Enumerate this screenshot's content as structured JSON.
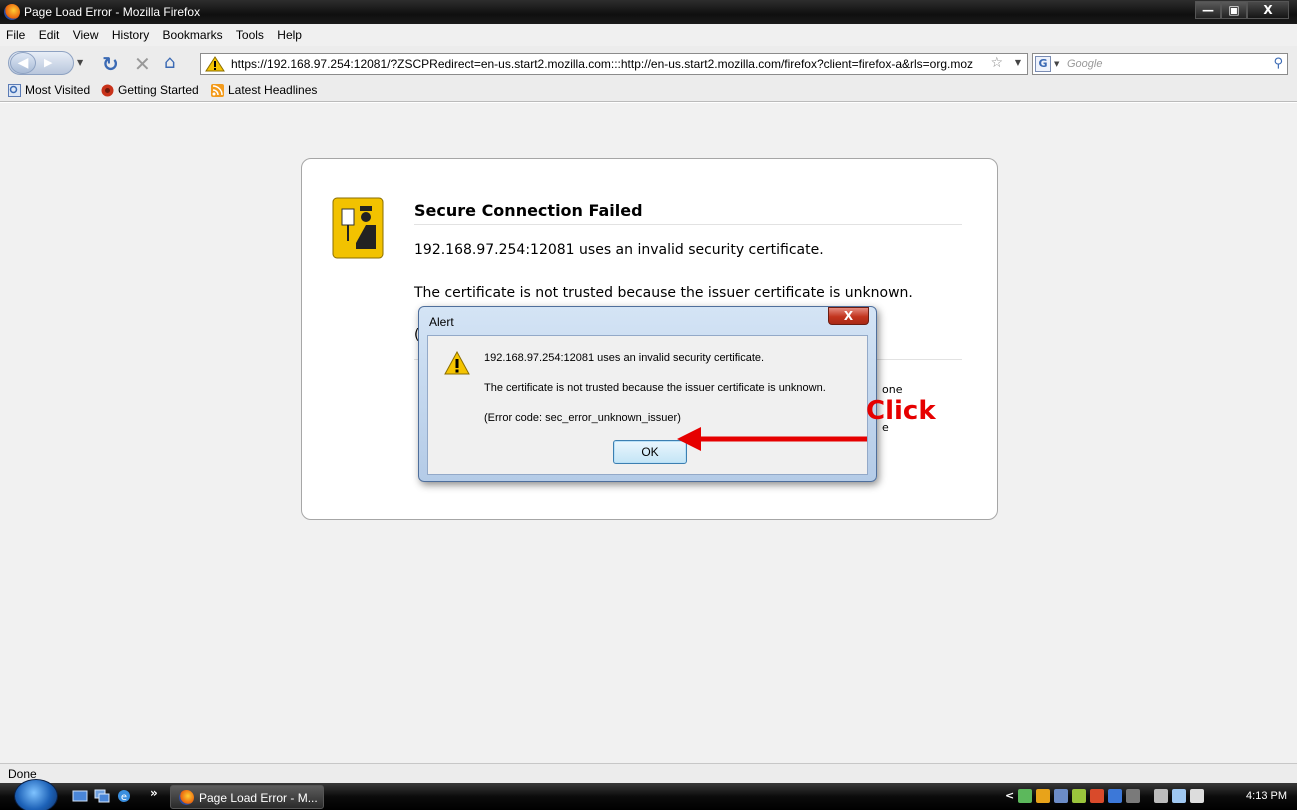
{
  "window": {
    "title": "Page Load Error - Mozilla Firefox",
    "controls": {
      "minimize": "—",
      "maximize": "▣",
      "close": "X"
    }
  },
  "menu": [
    "File",
    "Edit",
    "View",
    "History",
    "Bookmarks",
    "Tools",
    "Help"
  ],
  "navigation": {
    "url": "https://192.168.97.254:12081/?ZSCPRedirect=en-us.start2.mozilla.com:::http://en-us.start2.mozilla.com/firefox?client=firefox-a&rls=org.moz",
    "search_placeholder": "Google",
    "icons": [
      "back-icon",
      "forward-icon",
      "reload-icon",
      "stop-icon",
      "home-icon",
      "site-warning-icon",
      "bookmark-star-icon",
      "search-icon"
    ]
  },
  "bookmarks": [
    "Most Visited",
    "Getting Started",
    "Latest Headlines"
  ],
  "error_page": {
    "title": "Secure Connection Failed",
    "line1": "192.168.97.254:12081 uses an invalid security certificate.",
    "line2": "The certificate is not trusted because the issuer certificate is unknown.",
    "fragment_paren": "(",
    "fragment_one": "one",
    "fragment_e": "e"
  },
  "alert": {
    "title": "Alert",
    "close_label": "X",
    "messages": [
      "192.168.97.254:12081 uses an invalid security certificate.",
      "The certificate is not trusted because the issuer certificate is unknown.",
      "(Error code: sec_error_unknown_issuer)"
    ],
    "ok_label": "OK"
  },
  "annotation": {
    "label": "Click",
    "color": "#e60000"
  },
  "status": {
    "text": "Done"
  },
  "taskbar": {
    "task_label": "Page Load Error - M...",
    "more": "»",
    "clock": "4:13 PM",
    "tray_chevron": "<"
  },
  "colors": {
    "warning_yellow": "#f5c400",
    "title_bar": "#1a1a1a",
    "alert_frame": "#b4cbe7"
  }
}
